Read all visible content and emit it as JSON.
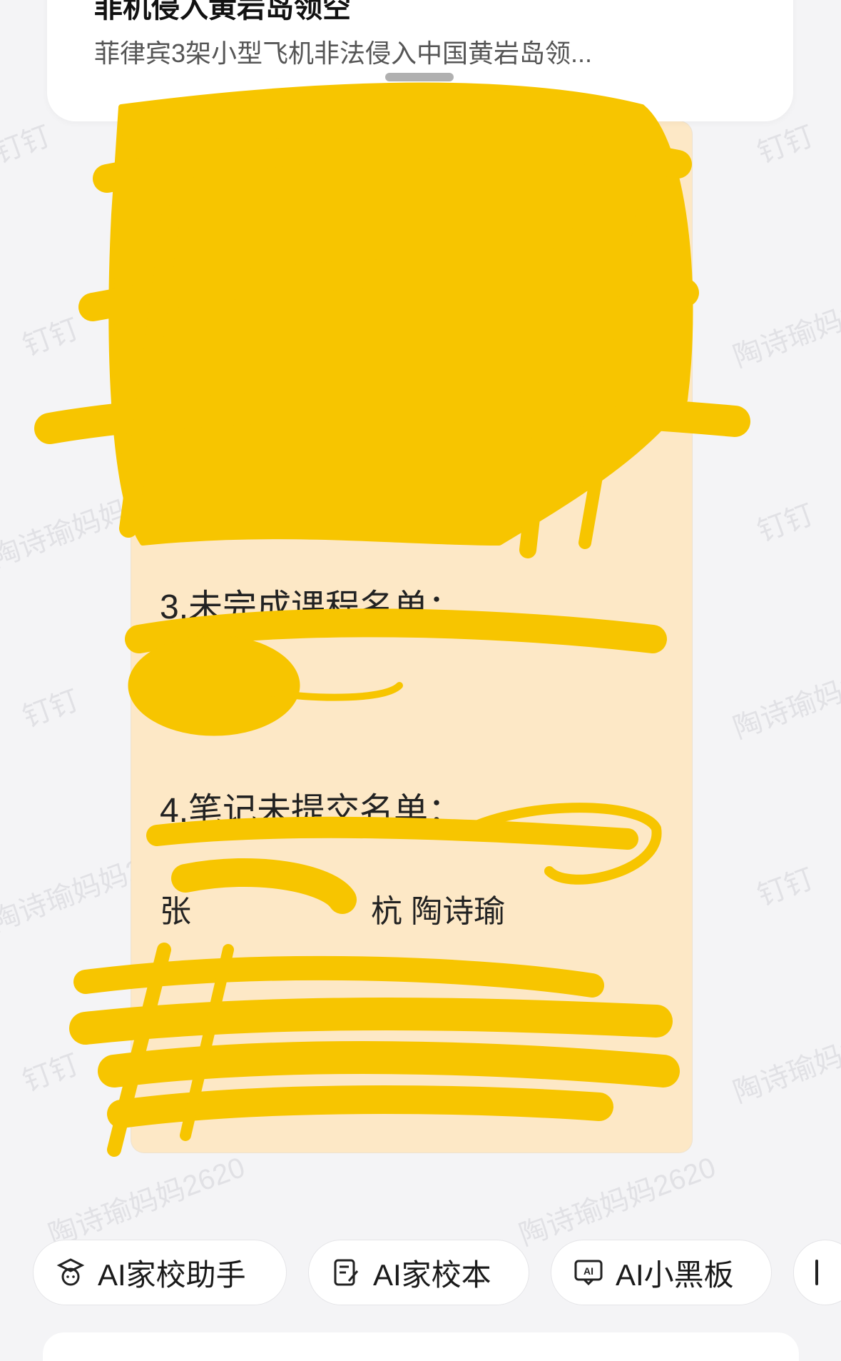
{
  "news": {
    "title": "菲机侵入黄岩岛领空",
    "subtitle": "菲律宾3架小型飞机非法侵入中国黄岩岛领..."
  },
  "message": {
    "section3_title": "3.未完成课程名单：",
    "section4_title": "4.笔记未提交名单：",
    "section4_names_line2": "张",
    "section4_names_visible": "杭 陶诗瑜"
  },
  "watermark": {
    "text_a": "钉钉",
    "text_b": "陶诗瑜妈妈2620"
  },
  "toolbar": {
    "items": [
      {
        "label": "AI家校助手",
        "icon": "assistant-face-icon"
      },
      {
        "label": "AI家校本",
        "icon": "notebook-edit-icon"
      },
      {
        "label": "AI小黑板",
        "icon": "ai-blackboard-icon"
      },
      {
        "label": "",
        "icon": "partial-item-icon"
      }
    ]
  },
  "colors": {
    "bubble_bg": "#fde8c6",
    "scribble": "#f7c500",
    "page_bg": "#f4f4f6"
  }
}
